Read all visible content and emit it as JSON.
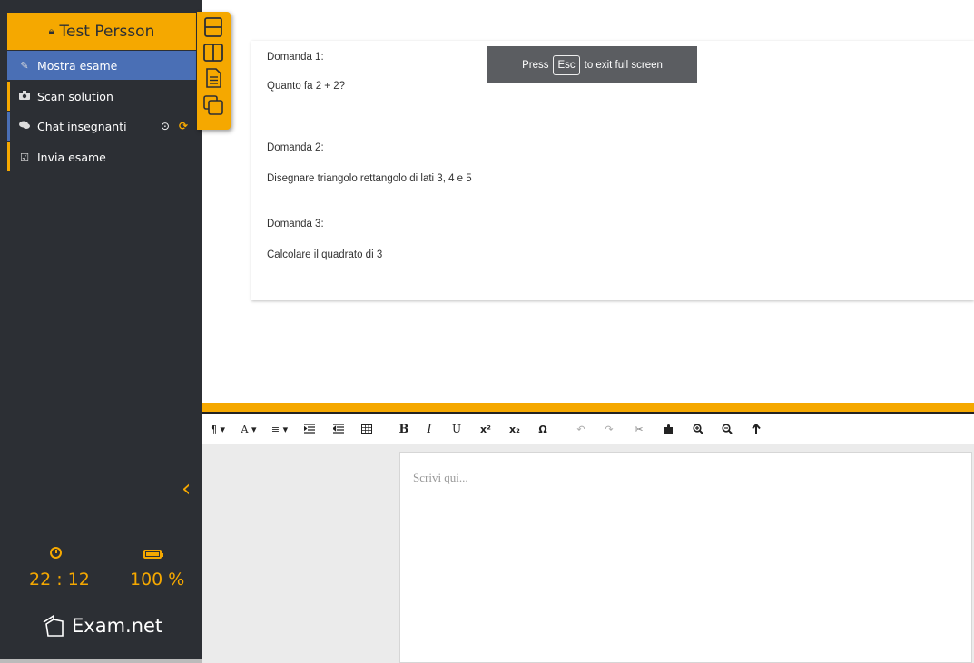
{
  "sidebar": {
    "user_name": "Test Persson",
    "items": [
      {
        "label": "Mostra esame",
        "icon": "edit-icon"
      },
      {
        "label": "Scan solution",
        "icon": "camera-icon"
      },
      {
        "label": "Chat insegnanti",
        "icon": "chat-icon"
      },
      {
        "label": "Invia esame",
        "icon": "checkbox-icon"
      }
    ],
    "time": "22 : 12",
    "battery": "100 %",
    "brand": "Exam.net"
  },
  "layout_toolbar": [
    "split-horizontal-icon",
    "split-vertical-icon",
    "document-icon",
    "copy-icon"
  ],
  "exam": {
    "questions": [
      {
        "label": "Domanda 1:",
        "text": "Quanto fa 2 + 2?"
      },
      {
        "label": "Domanda 2:",
        "text": "Disegnare triangolo rettangolo di lati 3, 4 e 5"
      },
      {
        "label": "Domanda 3:",
        "text": "Calcolare il quadrato di 3"
      }
    ]
  },
  "fullscreen": {
    "press": "Press",
    "key": "Esc",
    "rest": "to exit full screen"
  },
  "editor": {
    "placeholder": "Scrivi qui...",
    "toolbar": {
      "paragraph": "¶ ▾",
      "font": "A ▾",
      "align": "≡ ▾",
      "bold": "B",
      "italic": "I",
      "underline": "U",
      "superscript": "x²",
      "subscript": "x₂",
      "omega": "Ω",
      "undo": "↶",
      "redo": "↷"
    }
  },
  "colors": {
    "accent": "#f5a800",
    "sidebar": "#2c2f34",
    "active": "#4a6fb5"
  }
}
